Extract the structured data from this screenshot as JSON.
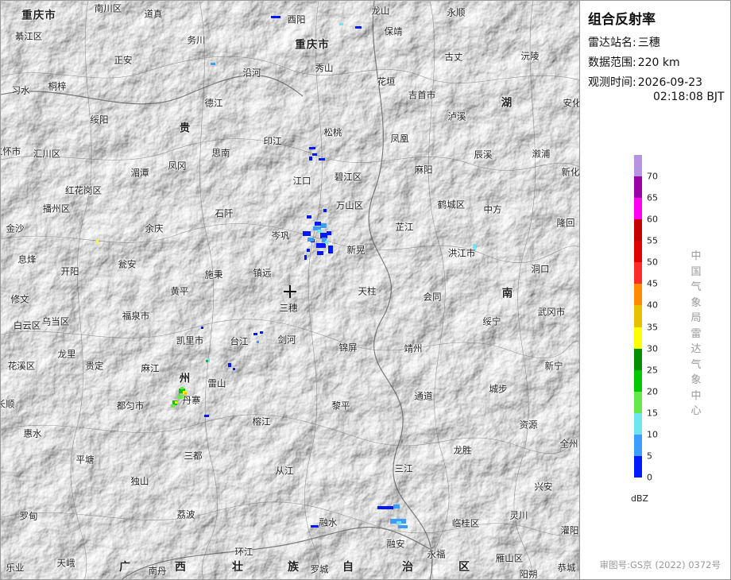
{
  "panel": {
    "title": "组合反射率",
    "station_label": "雷达站名:",
    "station_value": "三穗",
    "range_label": "数据范围:",
    "range_value": "220 km",
    "time_label": "观测时间:",
    "time_date": "2026-09-23",
    "time_clock": "02:18:08 BJT",
    "unit": "dBZ",
    "organization": "中国气象局雷达气象中心",
    "review_number": "审图号:GS京 (2022) 0372号"
  },
  "legend": [
    {
      "label": "70",
      "color": "#b794e0"
    },
    {
      "label": "65",
      "color": "#9b00a8"
    },
    {
      "label": "60",
      "color": "#ff00f0"
    },
    {
      "label": "55",
      "color": "#c40000"
    },
    {
      "label": "50",
      "color": "#e00000"
    },
    {
      "label": "45",
      "color": "#ff2a2a"
    },
    {
      "label": "40",
      "color": "#ff8a00"
    },
    {
      "label": "35",
      "color": "#e8c000"
    },
    {
      "label": "30",
      "color": "#ffff00"
    },
    {
      "label": "25",
      "color": "#009000"
    },
    {
      "label": "20",
      "color": "#00c800"
    },
    {
      "label": "15",
      "color": "#66e84a"
    },
    {
      "label": "10",
      "color": "#6ee6f0"
    },
    {
      "label": "5",
      "color": "#3c9cff"
    },
    {
      "label": "0",
      "color": "#0018ff"
    }
  ],
  "map": {
    "radar_site": "三穗",
    "places": [
      {
        "name": "重庆市"
      },
      {
        "name": "南川区"
      },
      {
        "name": "道真"
      },
      {
        "name": "酉阳"
      },
      {
        "name": "龙山"
      },
      {
        "name": "永顺"
      },
      {
        "name": "綦江区"
      },
      {
        "name": "务川"
      },
      {
        "name": "重庆市"
      },
      {
        "name": "保靖"
      },
      {
        "name": "正安"
      },
      {
        "name": "沿河"
      },
      {
        "name": "秀山"
      },
      {
        "name": "古丈"
      },
      {
        "name": "沅陵"
      },
      {
        "name": "习水"
      },
      {
        "name": "桐梓"
      },
      {
        "name": "花垣"
      },
      {
        "name": "吉首市"
      },
      {
        "name": "德江"
      },
      {
        "name": "泸溪"
      },
      {
        "name": "湖"
      },
      {
        "name": "安化"
      },
      {
        "name": "绥阳"
      },
      {
        "name": "贵"
      },
      {
        "name": "松桃"
      },
      {
        "name": "印江"
      },
      {
        "name": "凤凰"
      },
      {
        "name": "辰溪"
      },
      {
        "name": "溆浦"
      },
      {
        "name": "仁怀市"
      },
      {
        "name": "汇川区"
      },
      {
        "name": "思南"
      },
      {
        "name": "湄潭"
      },
      {
        "name": "凤冈"
      },
      {
        "name": "碧江区"
      },
      {
        "name": "江口"
      },
      {
        "name": "麻阳"
      },
      {
        "name": "鹤城区"
      },
      {
        "name": "新化"
      },
      {
        "name": "红花岗区"
      },
      {
        "name": "播州区"
      },
      {
        "name": "石阡"
      },
      {
        "name": "万山区"
      },
      {
        "name": "中方"
      },
      {
        "name": "隆回"
      },
      {
        "name": "金沙"
      },
      {
        "name": "余庆"
      },
      {
        "name": "岑巩"
      },
      {
        "name": "芷江"
      },
      {
        "name": "息烽"
      },
      {
        "name": "瓮安"
      },
      {
        "name": "新晃"
      },
      {
        "name": "洪江市"
      },
      {
        "name": "开阳"
      },
      {
        "name": "施秉"
      },
      {
        "name": "镇远"
      },
      {
        "name": "天柱"
      },
      {
        "name": "洞口"
      },
      {
        "name": "修文"
      },
      {
        "name": "黄平"
      },
      {
        "name": "三穗"
      },
      {
        "name": "会同"
      },
      {
        "name": "南"
      },
      {
        "name": "乌当区"
      },
      {
        "name": "福泉市"
      },
      {
        "name": "武冈市"
      },
      {
        "name": "白云区"
      },
      {
        "name": "凯里市"
      },
      {
        "name": "台江"
      },
      {
        "name": "剑河"
      },
      {
        "name": "锦屏"
      },
      {
        "name": "绥宁"
      },
      {
        "name": "龙里"
      },
      {
        "name": "贵定"
      },
      {
        "name": "靖州"
      },
      {
        "name": "花溪区"
      },
      {
        "name": "麻江"
      },
      {
        "name": "州"
      },
      {
        "name": "雷山"
      },
      {
        "name": "新宁"
      },
      {
        "name": "丹寨"
      },
      {
        "name": "都匀市"
      },
      {
        "name": "长顺"
      },
      {
        "name": "通道"
      },
      {
        "name": "城步"
      },
      {
        "name": "黎平"
      },
      {
        "name": "惠水"
      },
      {
        "name": "榕江"
      },
      {
        "name": "资源"
      },
      {
        "name": "三都"
      },
      {
        "name": "龙胜"
      },
      {
        "name": "全州"
      },
      {
        "name": "平塘"
      },
      {
        "name": "三江"
      },
      {
        "name": "独山"
      },
      {
        "name": "从江"
      },
      {
        "name": "兴安"
      },
      {
        "name": "荔波"
      },
      {
        "name": "罗甸"
      },
      {
        "name": "灵川"
      },
      {
        "name": "融水"
      },
      {
        "name": "临桂区"
      },
      {
        "name": "灌阳"
      },
      {
        "name": "环江"
      },
      {
        "name": "融安"
      },
      {
        "name": "永福"
      },
      {
        "name": "雁山区"
      },
      {
        "name": "乐业"
      },
      {
        "name": "天峨"
      },
      {
        "name": "南丹"
      },
      {
        "name": "罗城"
      },
      {
        "name": "阳朔"
      },
      {
        "name": "恭城"
      }
    ],
    "region_chars": [
      "广",
      "西",
      "壮",
      "族",
      "自",
      "治",
      "区"
    ]
  }
}
